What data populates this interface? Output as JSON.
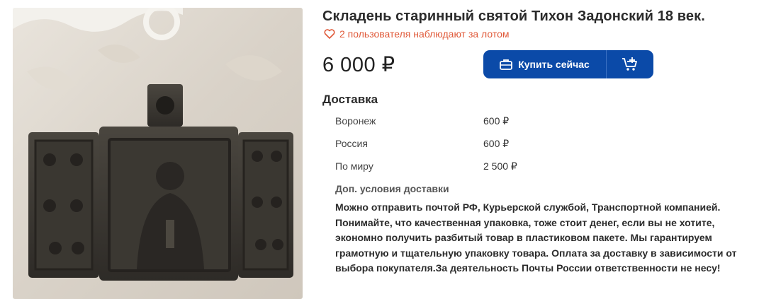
{
  "listing": {
    "title": "Складень старинный святой Тихон Задонский 18 век.",
    "watchers_text": "2 пользователя наблюдают за лотом",
    "price": "6 000 ₽",
    "photo_icon_name": "heart-icon"
  },
  "actions": {
    "buy_now_label": "Купить сейчас",
    "buy_icon": "briefcase-icon",
    "cart_icon": "add-to-cart-icon"
  },
  "delivery": {
    "title": "Доставка",
    "rows": [
      {
        "region": "Воронеж",
        "cost": "600 ₽"
      },
      {
        "region": "Россия",
        "cost": "600 ₽"
      },
      {
        "region": "По миру",
        "cost": "2 500 ₽"
      }
    ],
    "extra_title": "Доп. условия доставки",
    "extra_text": "Можно отправить почтой РФ, Курьерской службой, Транспортной компанией. Понимайте, что качественная упаковка, тоже стоит денег, если вы не хотите, экономно получить разбитый товар в пластиковом пакете. Мы гарантируем грамотную и тщательную упаковку товара. Оплата за доставку в зависимости от выбора покупателя.За деятельность Почты России ответственности не несу!"
  },
  "colors": {
    "accent": "#0b4aa8",
    "watchers": "#e05a3a"
  }
}
